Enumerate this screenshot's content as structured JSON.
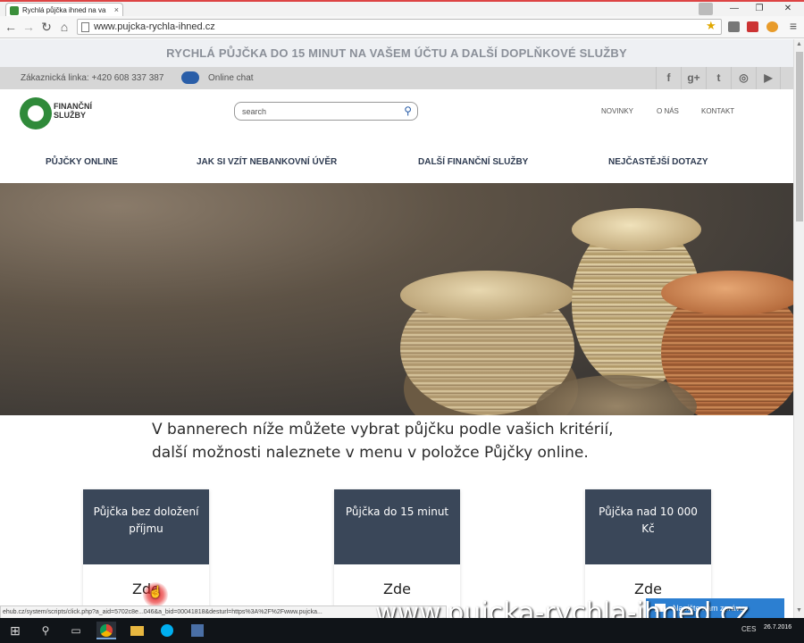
{
  "browser": {
    "tab_title": "Rychlá půjčka ihned na va",
    "tab_close": "×",
    "url": "www.pujcka-rychla-ihned.cz",
    "window_controls": {
      "minimize": "—",
      "restore": "❐",
      "close": "✕"
    },
    "nav": {
      "back": "←",
      "forward": "→",
      "reload": "↻",
      "home": "⌂"
    },
    "star": "★",
    "menu": "≡"
  },
  "site": {
    "promo_banner": "RYCHLÁ PŮJČKA DO 15 MINUT NA VAŠEM ÚČTU A DALŠÍ DOPLŇKOVÉ SLUŽBY",
    "info": {
      "phone": "Zákaznická linka: +420 608 337 387",
      "chat": "Online chat"
    },
    "social": [
      "f",
      "g+",
      "t",
      "◎",
      "▶"
    ],
    "logo_text": "FINANČNÍ SLUŽBY",
    "search_placeholder": "search",
    "search_icon": "⚲",
    "top_links": [
      "NOVINKY",
      "O NÁS",
      "KONTAKT"
    ],
    "main_nav": [
      "PŮJČKY ONLINE",
      "JAK SI VZÍT NEBANKOVNÍ ÚVĚR",
      "DALŠÍ FINANČNÍ SLUŽBY",
      "NEJČASTĚJŠÍ DOTAZY"
    ],
    "intro": [
      "V bannerech níže můžete vybrat půjčku podle vašich kritérií,",
      "další možnosti naleznete v menu v položce Půjčky online."
    ],
    "cards": [
      {
        "title": "Půjčka bez doložení příjmu",
        "button": "Zde"
      },
      {
        "title": "Půjčka do 15 minut",
        "button": "Zde"
      },
      {
        "title": "Půjčka nad 10 000 Kč",
        "button": "Zde"
      }
    ],
    "status_url": "ehub.cz/system/scripts/click.php?a_aid=5702c8e...046&a_bid=00041818&desturl=https%3A%2F%2Fwww.pujcka...",
    "message_button": "Napište nám zprávu",
    "watermark": "www.pujcka-rychla-ihned.cz"
  },
  "taskbar": {
    "start": "⊞",
    "search": "⚲",
    "task_view": "▭",
    "tray_lang": "CES",
    "time": "26.7.2016"
  },
  "colors": {
    "card_head": "#3a4759",
    "accent_blue": "#2c7fd1",
    "logo_green": "#2f8a3a"
  }
}
